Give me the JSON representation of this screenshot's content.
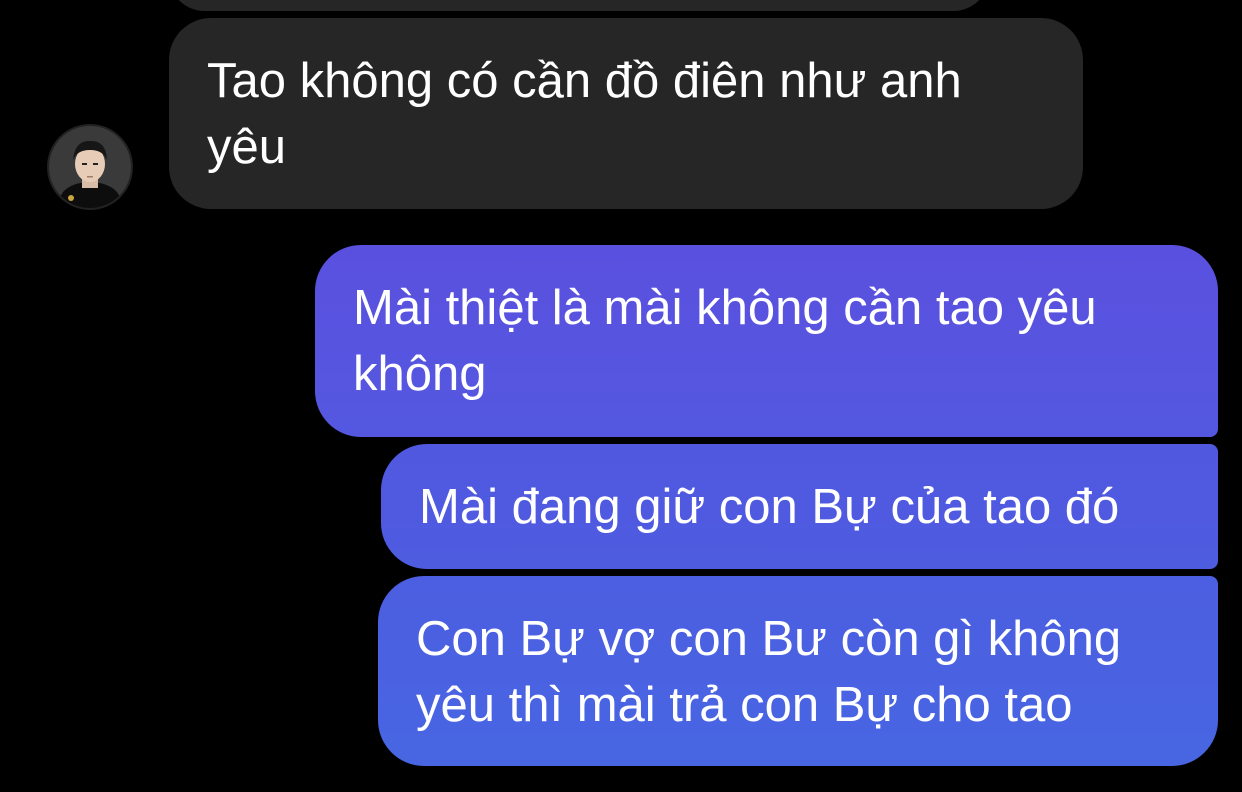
{
  "messages": [
    {
      "direction": "incoming",
      "text": "Tao không có cần đồ điên như anh\nyêu"
    },
    {
      "direction": "outgoing",
      "text": "Mài thiệt là mài không cần tao yêu\nkhông"
    },
    {
      "direction": "outgoing",
      "text": "Mài đang giữ con Bự của tao đó"
    },
    {
      "direction": "outgoing",
      "text": "Con Bự vợ con Bư còn gì không\nyêu thì mài trả con Bự cho tao"
    }
  ],
  "colors": {
    "background": "#000000",
    "incoming_bubble": "#262626",
    "outgoing_bubble_top": "#5a50df",
    "outgoing_bubble_bottom": "#4866e2",
    "text": "#ffffff"
  },
  "contact": {
    "avatar_icon": "user-avatar-photo"
  }
}
